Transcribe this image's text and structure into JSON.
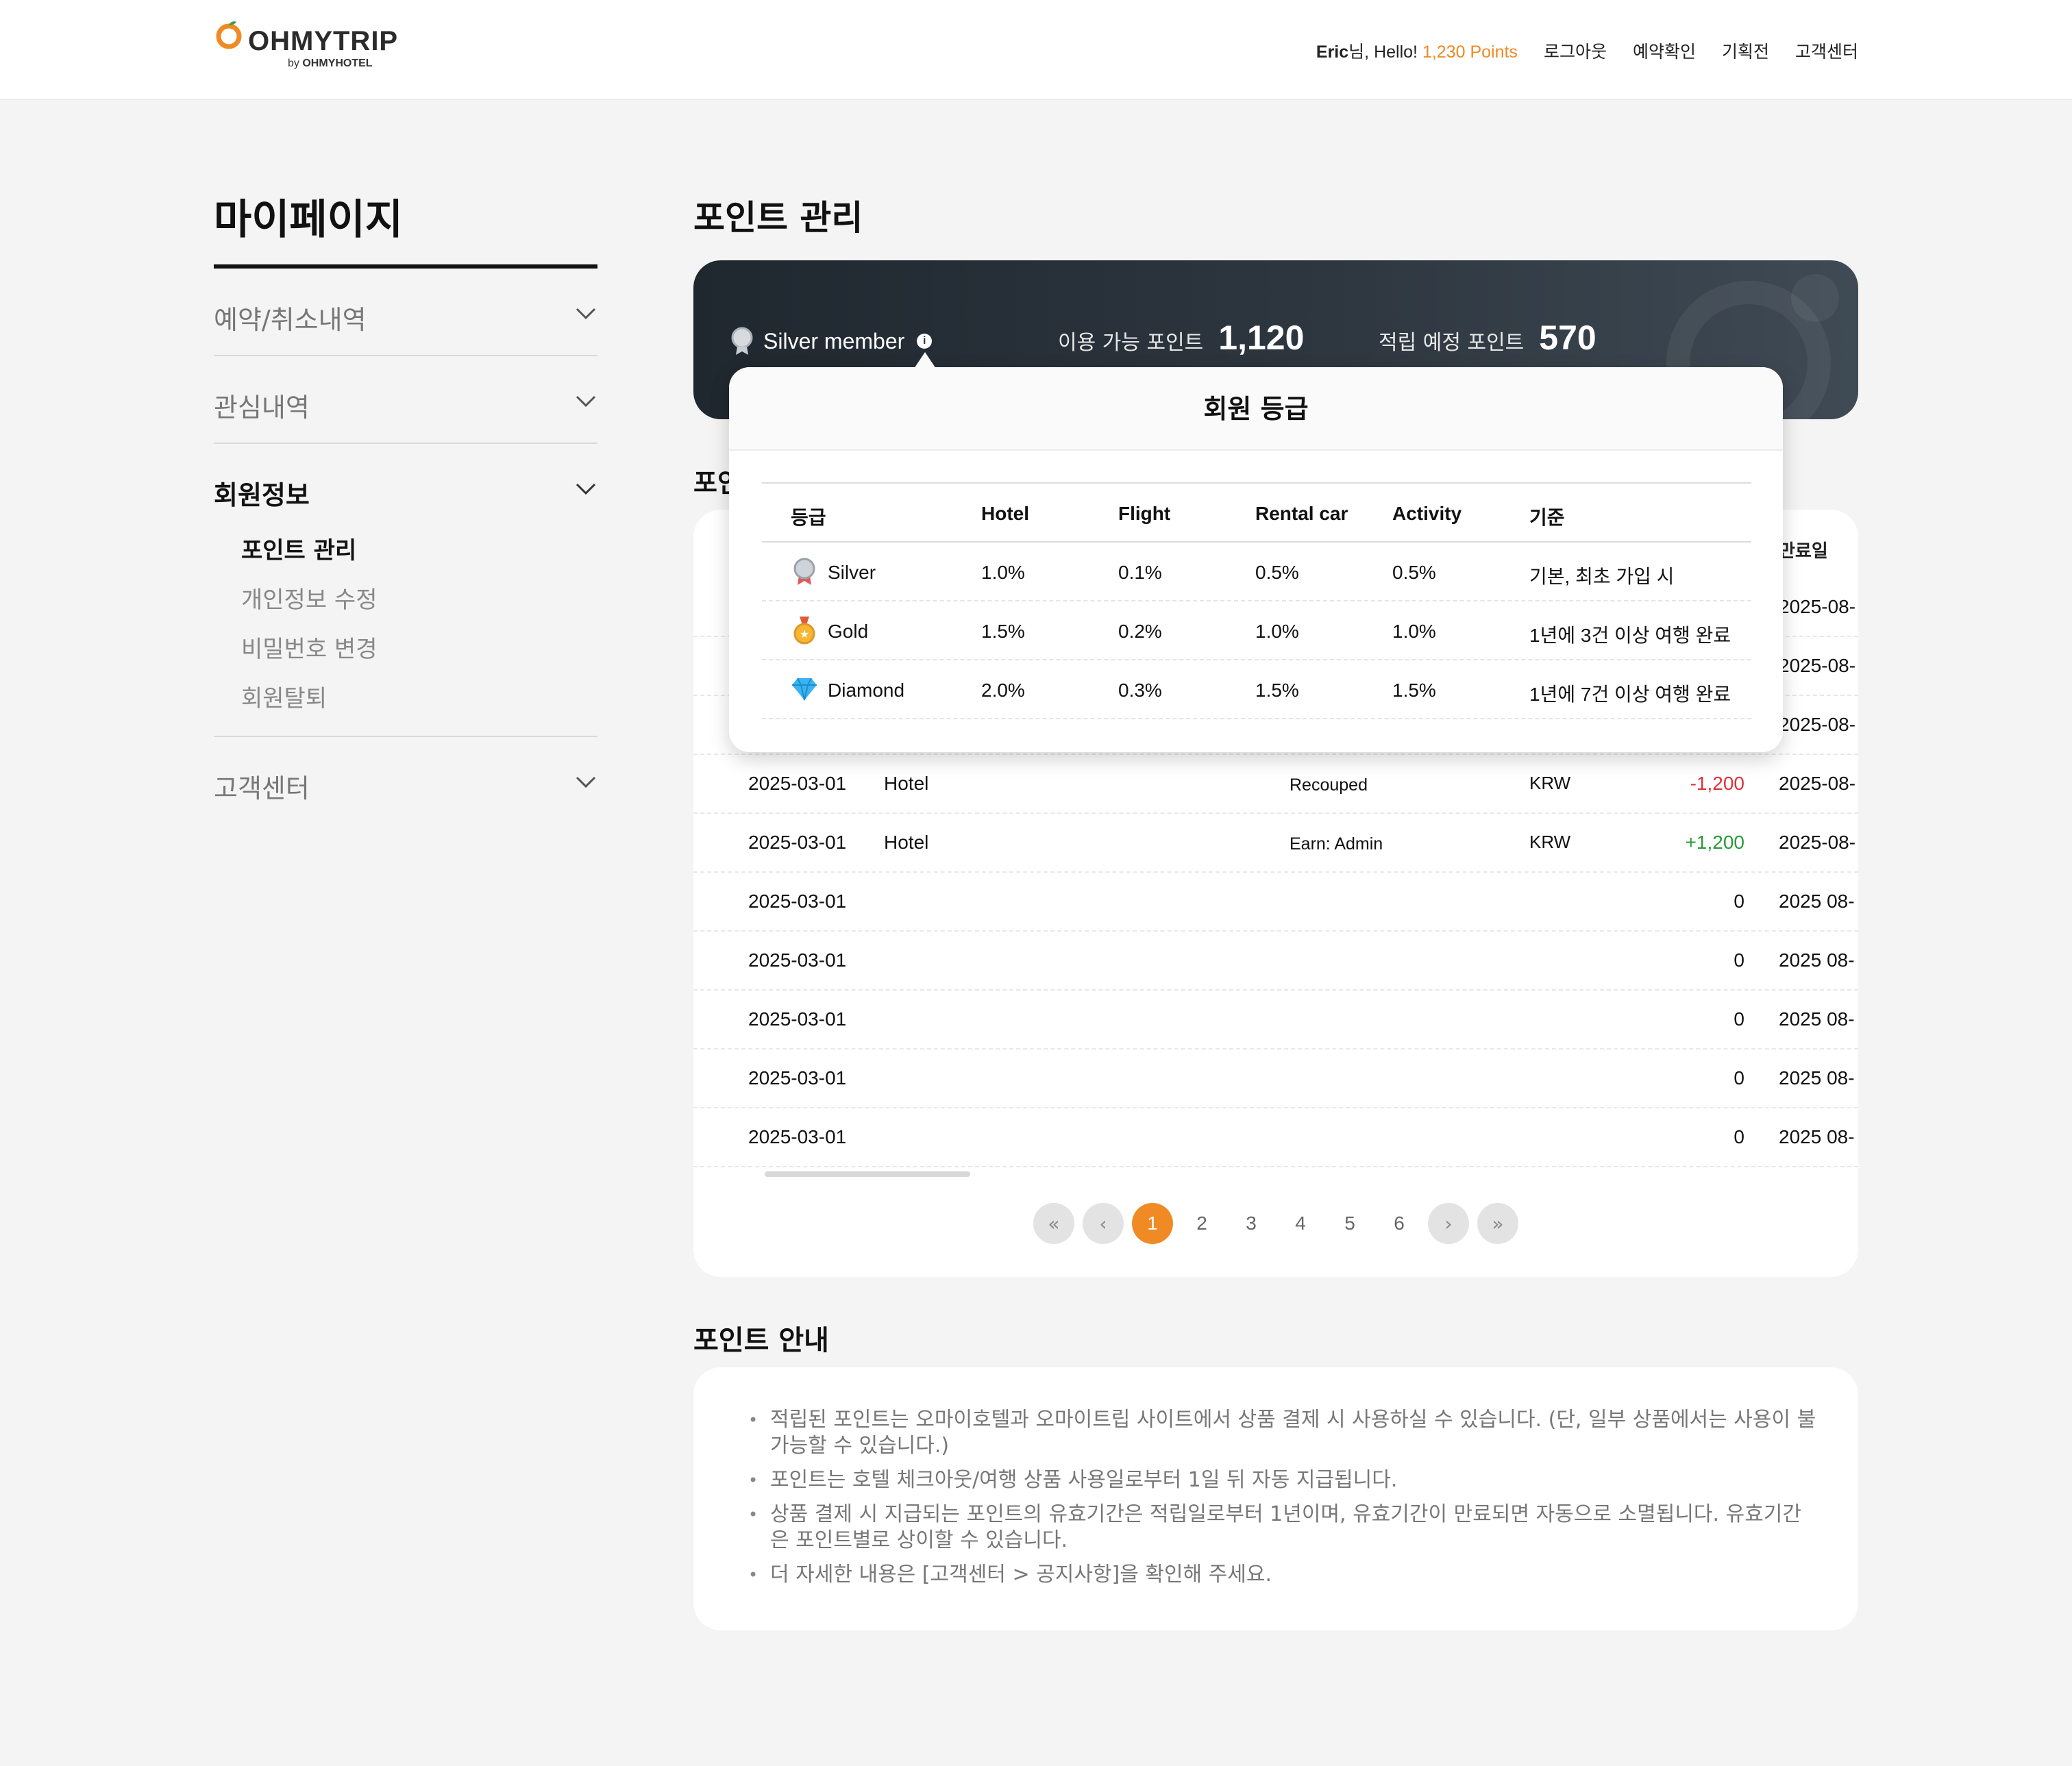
{
  "header": {
    "logo_text": "OHMYTRIP",
    "logo_sub_prefix": "by",
    "logo_sub_brand": "OHMYHOTEL",
    "greet_user": "Eric",
    "greet_mid": "님, Hello!",
    "greet_points": "1,230 Points",
    "nav": [
      "로그아웃",
      "예약확인",
      "기획전",
      "고객센터"
    ]
  },
  "sidebar": {
    "title": "마이페이지",
    "items": [
      "예약/취소내역",
      "관심내역",
      "회원정보",
      "고객센터"
    ],
    "sub_items": [
      "포인트 관리",
      "개인정보 수정",
      "비밀번호 변경",
      "회원탈퇴"
    ]
  },
  "main": {
    "title": "포인트 관리",
    "tier_label": "Silver member",
    "info_glyph": "i",
    "available_label": "이용 가능 포인트",
    "available_value": "1,120",
    "pending_label": "적립 예정 포인트",
    "pending_value": "570",
    "section_partial": "포인",
    "exp_header_partial": "만료일",
    "rows": [
      {
        "date": "",
        "cat": "",
        "type": "",
        "cur": "",
        "amt": "",
        "exp": "2025-08-",
        "cls": ""
      },
      {
        "date": "",
        "cat": "",
        "type": "",
        "cur": "",
        "amt": "",
        "exp": "2025-08-",
        "cls": ""
      },
      {
        "date": "",
        "cat": "",
        "type": "",
        "cur": "",
        "amt": "",
        "exp": "2025-08-",
        "cls": ""
      },
      {
        "date": "2025-03-01",
        "cat": "Hotel",
        "type": "Recouped",
        "cur": "KRW",
        "amt": "-1,200",
        "exp": "2025-08-",
        "cls": "neg"
      },
      {
        "date": "2025-03-01",
        "cat": "Hotel",
        "type": "Earn: Admin",
        "cur": "KRW",
        "amt": "+1,200",
        "exp": "2025-08-",
        "cls": "pos"
      },
      {
        "date": "2025-03-01",
        "cat": "",
        "type": "",
        "cur": "",
        "amt": "0",
        "exp": "2025 08-",
        "cls": ""
      },
      {
        "date": "2025-03-01",
        "cat": "",
        "type": "",
        "cur": "",
        "amt": "0",
        "exp": "2025 08-",
        "cls": ""
      },
      {
        "date": "2025-03-01",
        "cat": "",
        "type": "",
        "cur": "",
        "amt": "0",
        "exp": "2025 08-",
        "cls": ""
      },
      {
        "date": "2025-03-01",
        "cat": "",
        "type": "",
        "cur": "",
        "amt": "0",
        "exp": "2025 08-",
        "cls": ""
      },
      {
        "date": "2025-03-01",
        "cat": "",
        "type": "",
        "cur": "",
        "amt": "0",
        "exp": "2025 08-",
        "cls": ""
      }
    ],
    "pagination": {
      "pages": [
        "1",
        "2",
        "3",
        "4",
        "5",
        "6"
      ],
      "current": "1"
    }
  },
  "popup": {
    "title": "회원 등급",
    "headers": [
      "등급",
      "Hotel",
      "Flight",
      "Rental car",
      "Activity",
      "기준"
    ],
    "grades": [
      {
        "name": "Silver",
        "icon": "silver-medal-icon",
        "hotel": "1.0%",
        "flight": "0.1%",
        "rental": "0.5%",
        "activity": "0.5%",
        "criteria": "기본, 최초 가입 시"
      },
      {
        "name": "Gold",
        "icon": "gold-medal-icon",
        "hotel": "1.5%",
        "flight": "0.2%",
        "rental": "1.0%",
        "activity": "1.0%",
        "criteria": "1년에 3건 이상 여행 완료"
      },
      {
        "name": "Diamond",
        "icon": "diamond-icon",
        "hotel": "2.0%",
        "flight": "0.3%",
        "rental": "1.5%",
        "activity": "1.5%",
        "criteria": "1년에 7건 이상 여행 완료"
      }
    ]
  },
  "guide": {
    "title": "포인트 안내",
    "items": [
      "적립된 포인트는 오마이호텔과 오마이트립 사이트에서 상품 결제 시 사용하실 수 있습니다. (단, 일부 상품에서는 사용이 불가능할 수 있습니다.)",
      "포인트는 호텔 체크아웃/여행 상품 사용일로부터 1일 뒤 자동 지급됩니다.",
      "상품 결제 시 지급되는 포인트의 유효기간은 적립일로부터 1년이며, 유효기간이 만료되면 자동으로 소멸됩니다. 유효기간은 포인트별로 상이할 수 있습니다.",
      "더 자세한 내용은 [고객센터 > 공지사항]을 확인해 주세요."
    ]
  },
  "colors": {
    "accent": "#f08a24",
    "negative": "#e0303a",
    "positive": "#2a9a3a",
    "banner": "#2e3740"
  }
}
